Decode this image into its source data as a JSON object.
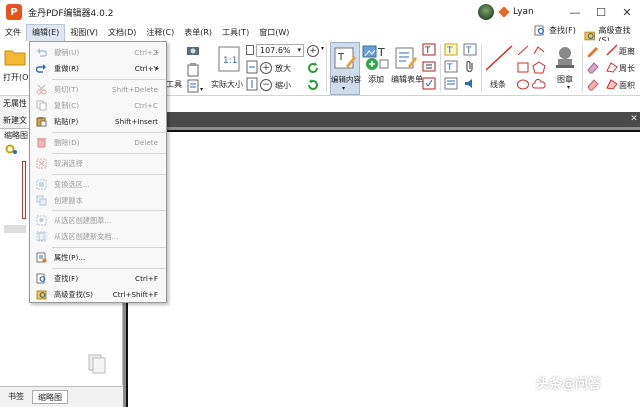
{
  "app": {
    "title": "金丹PDF编辑器4.0.2",
    "logo_char": "P",
    "user_name": "Lyan"
  },
  "window_controls": [
    "—",
    "☐",
    "✕"
  ],
  "menubar": {
    "items": [
      "文件",
      "编辑(E)",
      "视图(V)",
      "文档(D)",
      "注释(C)",
      "表单(R)",
      "工具(T)",
      "窗口(W)"
    ],
    "right": [
      "查找(F)",
      "高级查找(S)"
    ]
  },
  "ribbon": {
    "zoom_value": "107.6%",
    "zoom_in_label": "放大",
    "zoom_out_label": "缩小",
    "actual_size_label": "实际大小",
    "edit_content_label": "编辑内容",
    "add_label": "添加",
    "edit_form_label": "编辑表单",
    "line_label": "线条",
    "stamp_label": "图章",
    "distance_label": "距离",
    "perimeter_label": "周长",
    "area_label": "面积",
    "tool_partial": "工具",
    "open_label": "打开(O)"
  },
  "left_panel": {
    "no_attr": "无属性",
    "new_doc": "新建文",
    "thumb_header": "缩略图",
    "bottom_tabs": [
      "书签",
      "缩略图"
    ],
    "active_tab": "缩略图"
  },
  "edit_menu": {
    "items": [
      {
        "label": "撤销(U)",
        "shortcut": "Ctrl+Z",
        "disabled": true,
        "submenu": true,
        "icon": "undo-icon"
      },
      {
        "label": "重做(R)",
        "shortcut": "Ctrl+Y",
        "disabled": false,
        "submenu": true,
        "icon": "redo-icon"
      },
      {
        "label": "剪切(T)",
        "shortcut": "Shift+Delete",
        "disabled": true,
        "icon": "scissors-icon"
      },
      {
        "label": "复制(C)",
        "shortcut": "Ctrl+C",
        "disabled": true,
        "icon": "copy-icon"
      },
      {
        "label": "粘贴(P)",
        "shortcut": "Shift+Insert",
        "disabled": false,
        "icon": "paste-icon"
      },
      {
        "label": "删除(D)",
        "shortcut": "Delete",
        "disabled": true,
        "icon": "trash-icon"
      },
      {
        "label": "取消选择",
        "shortcut": "",
        "disabled": true,
        "icon": "deselect-icon"
      },
      {
        "label": "变换选区...",
        "shortcut": "",
        "disabled": true,
        "icon": "transform-icon"
      },
      {
        "label": "创建副本",
        "shortcut": "",
        "disabled": true,
        "icon": "duplicate-icon"
      },
      {
        "label": "从选区创建图章...",
        "shortcut": "",
        "disabled": true,
        "icon": "stamp-icon"
      },
      {
        "label": "从选区创建新文档...",
        "shortcut": "",
        "disabled": true,
        "icon": "new-doc-icon"
      },
      {
        "label": "属性(P)...",
        "shortcut": "",
        "disabled": false,
        "icon": "properties-icon"
      },
      {
        "label": "查找(F)",
        "shortcut": "Ctrl+F",
        "disabled": false,
        "icon": "find-icon"
      },
      {
        "label": "高级查找(S)",
        "shortcut": "Ctrl+Shift+F",
        "disabled": false,
        "icon": "advanced-find-icon"
      }
    ]
  },
  "watermark": "头条@问答",
  "colors": {
    "menu_highlight": "#dfe7f3",
    "doc_background": "#8c8c8c",
    "logo": "#e8531b"
  }
}
